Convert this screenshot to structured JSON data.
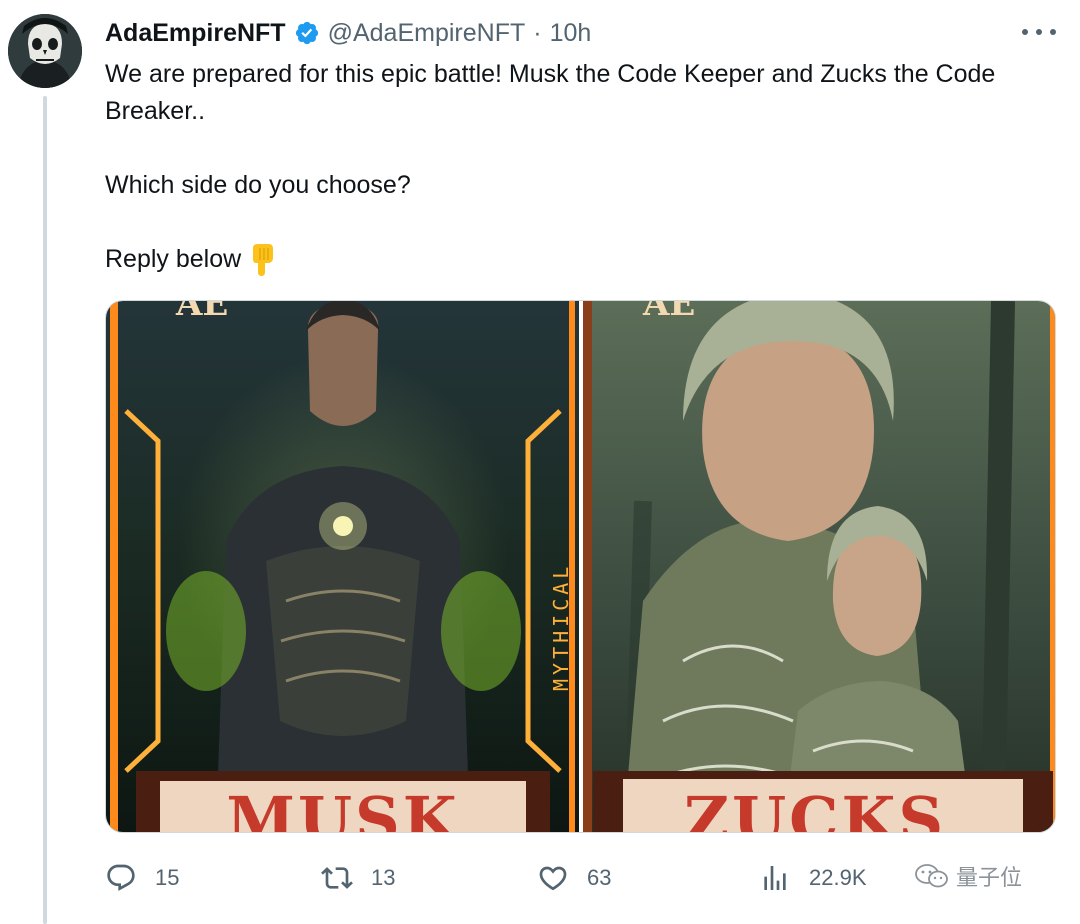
{
  "tweet": {
    "display_name": "AdaEmpireNFT",
    "handle": "@AdaEmpireNFT",
    "separator": "·",
    "time": "10h",
    "text_lines": [
      "We are prepared for this epic battle! Musk the Code Keeper and Zucks the Code Breaker..",
      "Which side do you choose?",
      "Reply below"
    ],
    "emoji": "backhand-index-pointing-down"
  },
  "media": {
    "left_card": {
      "nameplate": "MUSK",
      "side_label": "MYTHICAL",
      "top_label": "AE"
    },
    "right_card": {
      "nameplate": "ZUCKS",
      "top_label": "AE"
    }
  },
  "actions": {
    "replies": "15",
    "retweets": "13",
    "likes": "63",
    "views": "22.9K"
  },
  "watermark": {
    "text": "量子位"
  },
  "colors": {
    "verified": "#1d9bf0",
    "muted": "#536471",
    "text": "#0f1419",
    "thread_line": "#cfd9de"
  }
}
